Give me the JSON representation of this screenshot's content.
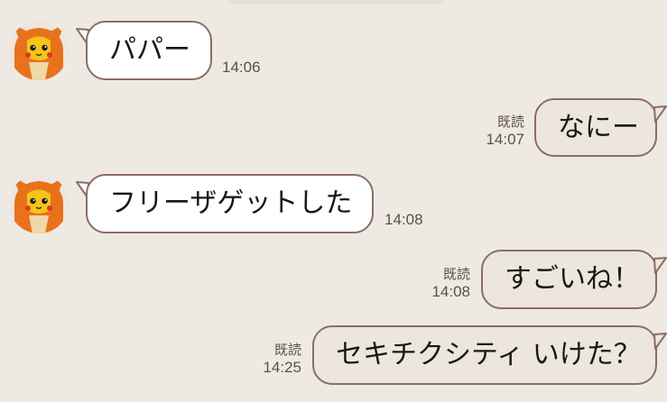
{
  "messages": [
    {
      "direction": "incoming",
      "text": "パパー",
      "time": "14:06"
    },
    {
      "direction": "outgoing",
      "text": "なにー",
      "time": "14:07",
      "read": "既読"
    },
    {
      "direction": "incoming",
      "text": "フリーザゲットした",
      "time": "14:08"
    },
    {
      "direction": "outgoing",
      "text": "すごいね！",
      "time": "14:08",
      "read": "既読"
    },
    {
      "direction": "outgoing",
      "text": "セキチクシティ いけた？",
      "time": "14:25",
      "read": "既読"
    }
  ],
  "colors": {
    "background": "#efe9e4",
    "bubble_incoming": "#ffffff",
    "bubble_outgoing": "#ece6df",
    "bubble_border": "#8b6d63",
    "meta_text": "#5b5047"
  },
  "icons": {
    "avatar": "pikachu-charizard-costume-avatar"
  }
}
